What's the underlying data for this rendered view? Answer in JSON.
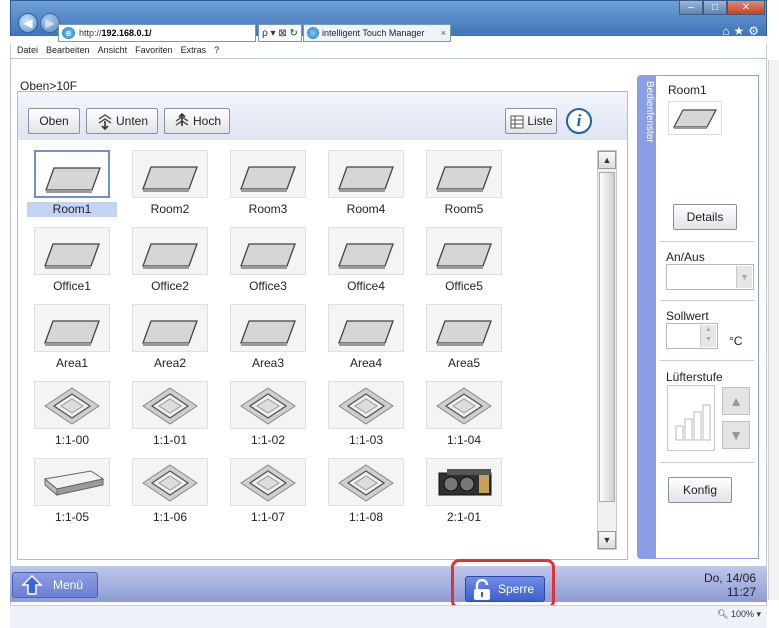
{
  "browser": {
    "address_prefix": "http://",
    "address_host": "192.168.0.1/",
    "address_controls": "ρ ▾ ⊠ ↻ ✕",
    "tab_title": "intelligent Touch Manager",
    "menu": [
      "Datei",
      "Bearbeiten",
      "Ansicht",
      "Favoriten",
      "Extras",
      "?"
    ],
    "zoom": "100%"
  },
  "breadcrumb": "Oben>10F",
  "toolbar": {
    "oben": "Oben",
    "unten": "Unten",
    "hoch": "Hoch",
    "liste": "Liste",
    "info": "i"
  },
  "grid": [
    {
      "label": "Room1",
      "icon": "ceiling-panel-icon",
      "selected": true
    },
    {
      "label": "Room2",
      "icon": "ceiling-panel-icon"
    },
    {
      "label": "Room3",
      "icon": "ceiling-panel-icon"
    },
    {
      "label": "Room4",
      "icon": "ceiling-panel-icon"
    },
    {
      "label": "Room5",
      "icon": "ceiling-panel-icon"
    },
    {
      "label": "Office1",
      "icon": "ceiling-panel-icon"
    },
    {
      "label": "Office2",
      "icon": "ceiling-panel-icon"
    },
    {
      "label": "Office3",
      "icon": "ceiling-panel-icon"
    },
    {
      "label": "Office4",
      "icon": "ceiling-panel-icon"
    },
    {
      "label": "Office5",
      "icon": "ceiling-panel-icon"
    },
    {
      "label": "Area1",
      "icon": "ceiling-panel-icon"
    },
    {
      "label": "Area2",
      "icon": "ceiling-panel-icon"
    },
    {
      "label": "Area3",
      "icon": "ceiling-panel-icon"
    },
    {
      "label": "Area4",
      "icon": "ceiling-panel-icon"
    },
    {
      "label": "Area5",
      "icon": "ceiling-panel-icon"
    },
    {
      "label": "1:1-00",
      "icon": "cassette-unit-icon"
    },
    {
      "label": "1:1-01",
      "icon": "cassette-unit-icon"
    },
    {
      "label": "1:1-02",
      "icon": "cassette-unit-icon"
    },
    {
      "label": "1:1-03",
      "icon": "cassette-unit-icon"
    },
    {
      "label": "1:1-04",
      "icon": "cassette-unit-icon"
    },
    {
      "label": "1:1-05",
      "icon": "ceiling-suspended-unit-icon"
    },
    {
      "label": "1:1-06",
      "icon": "cassette-unit-icon"
    },
    {
      "label": "1:1-07",
      "icon": "cassette-unit-icon"
    },
    {
      "label": "1:1-08",
      "icon": "cassette-unit-icon"
    },
    {
      "label": "2:1-01",
      "icon": "ventilation-unit-icon"
    }
  ],
  "side": {
    "tab_label": "Bedienfenster",
    "selected_name": "Room1",
    "details": "Details",
    "onoff_label": "An/Aus",
    "setpoint_label": "Sollwert",
    "setpoint_unit": "°C",
    "fan_label": "Lüfterstufe",
    "konfig": "Konfig"
  },
  "status": {
    "menu": "Menü",
    "lock": "Sperre",
    "date": "Do, 14/06",
    "time": "11:27"
  },
  "colors": {
    "accent": "#8b9ee3",
    "highlight": "#e0303a",
    "selected_cell": "#c3d3f3"
  }
}
